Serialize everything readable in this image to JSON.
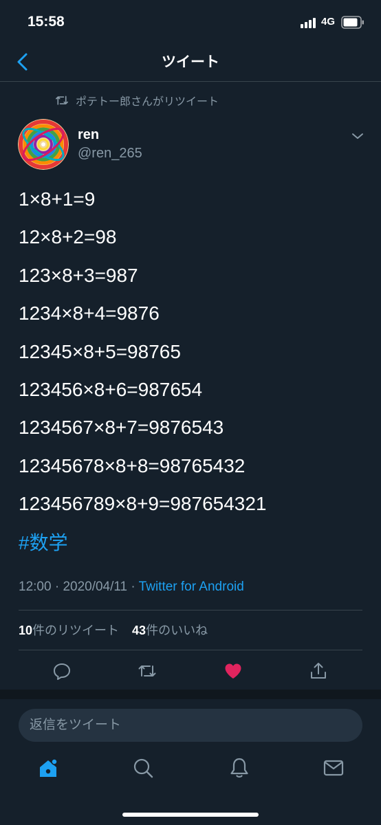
{
  "status_bar": {
    "time": "15:58",
    "network": "4G"
  },
  "header": {
    "title": "ツイート"
  },
  "retweet_context": {
    "text": "ポテトー郎さんがリツイート"
  },
  "author": {
    "name": "ren",
    "handle": "@ren_265"
  },
  "tweet": {
    "lines": [
      "1×8+1=9",
      "12×8+2=98",
      "123×8+3=987",
      "1234×8+4=9876",
      "12345×8+5=98765",
      "123456×8+6=987654",
      "1234567×8+7=9876543",
      "12345678×8+8=98765432",
      "123456789×8+9=987654321"
    ],
    "hashtag": "#数学",
    "time": "12:00",
    "separator": " · ",
    "date": "2020/04/11",
    "source": "Twitter for Android"
  },
  "stats": {
    "retweets_count": "10",
    "retweets_label": "件のリツイート",
    "likes_count": "43",
    "likes_label": "件のいいね"
  },
  "actions": [
    {
      "icon": "reply-icon"
    },
    {
      "icon": "retweet-icon"
    },
    {
      "icon": "like-icon",
      "active": true,
      "color": "#e0245e"
    },
    {
      "icon": "share-icon"
    }
  ],
  "reply": {
    "placeholder": "返信をツイート"
  },
  "tabbar": [
    {
      "icon": "home-icon",
      "active": true
    },
    {
      "icon": "search-icon"
    },
    {
      "icon": "notifications-icon"
    },
    {
      "icon": "messages-icon"
    }
  ],
  "colors": {
    "background": "#15202b",
    "accent": "#1da1f2",
    "secondary_text": "#8899a6",
    "divider": "#38444d",
    "like": "#e0245e"
  }
}
